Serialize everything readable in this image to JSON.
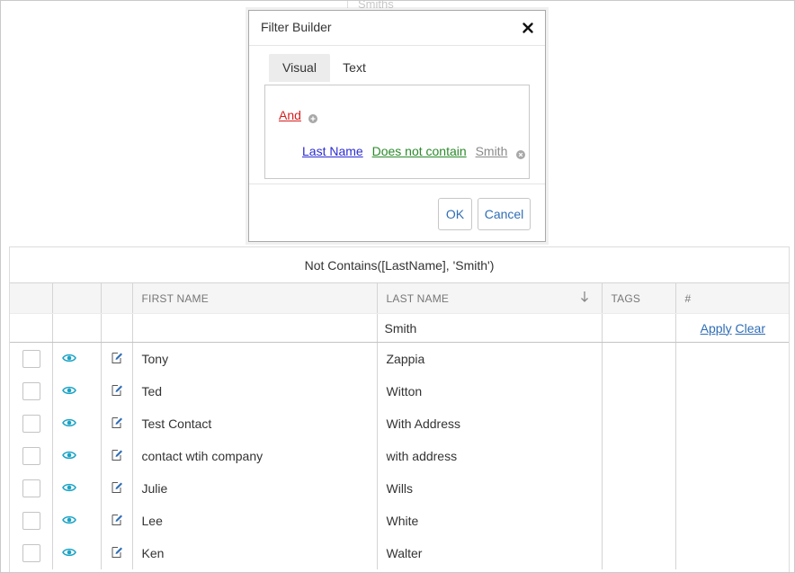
{
  "background_ghost": {
    "text": "Smiths"
  },
  "modal": {
    "title": "Filter Builder",
    "tabs": [
      {
        "label": "Visual",
        "active": true
      },
      {
        "label": "Text",
        "active": false
      }
    ],
    "group_operator": "And",
    "condition": {
      "field": "Last Name",
      "operator": "Does not contain",
      "value": "Smith"
    },
    "ok_label": "OK",
    "cancel_label": "Cancel"
  },
  "grid": {
    "filter_expression": "Not Contains([LastName], 'Smith')",
    "columns": [
      "",
      "",
      "",
      "FIRST NAME",
      "LAST NAME",
      "TAGS",
      "#"
    ],
    "sort_column": "LAST NAME",
    "filter_row": {
      "last_name": "Smith",
      "apply_label": "Apply",
      "clear_label": "Clear"
    },
    "rows": [
      {
        "first_name": "Tony",
        "last_name": "Zappia"
      },
      {
        "first_name": "Ted",
        "last_name": "Witton"
      },
      {
        "first_name": "Test Contact",
        "last_name": "With Address"
      },
      {
        "first_name": "contact wtih company",
        "last_name": "with address"
      },
      {
        "first_name": "Julie",
        "last_name": "Wills"
      },
      {
        "first_name": "Lee",
        "last_name": "White"
      },
      {
        "first_name": "Ken",
        "last_name": "Walter"
      }
    ]
  },
  "colors": {
    "and_operator": "#d51e1e",
    "field": "#2c2cd3",
    "operator": "#2a8a2a",
    "value": "#8a8a8a",
    "link": "#2f6eb5",
    "eye_icon": "#1ba3c6"
  }
}
